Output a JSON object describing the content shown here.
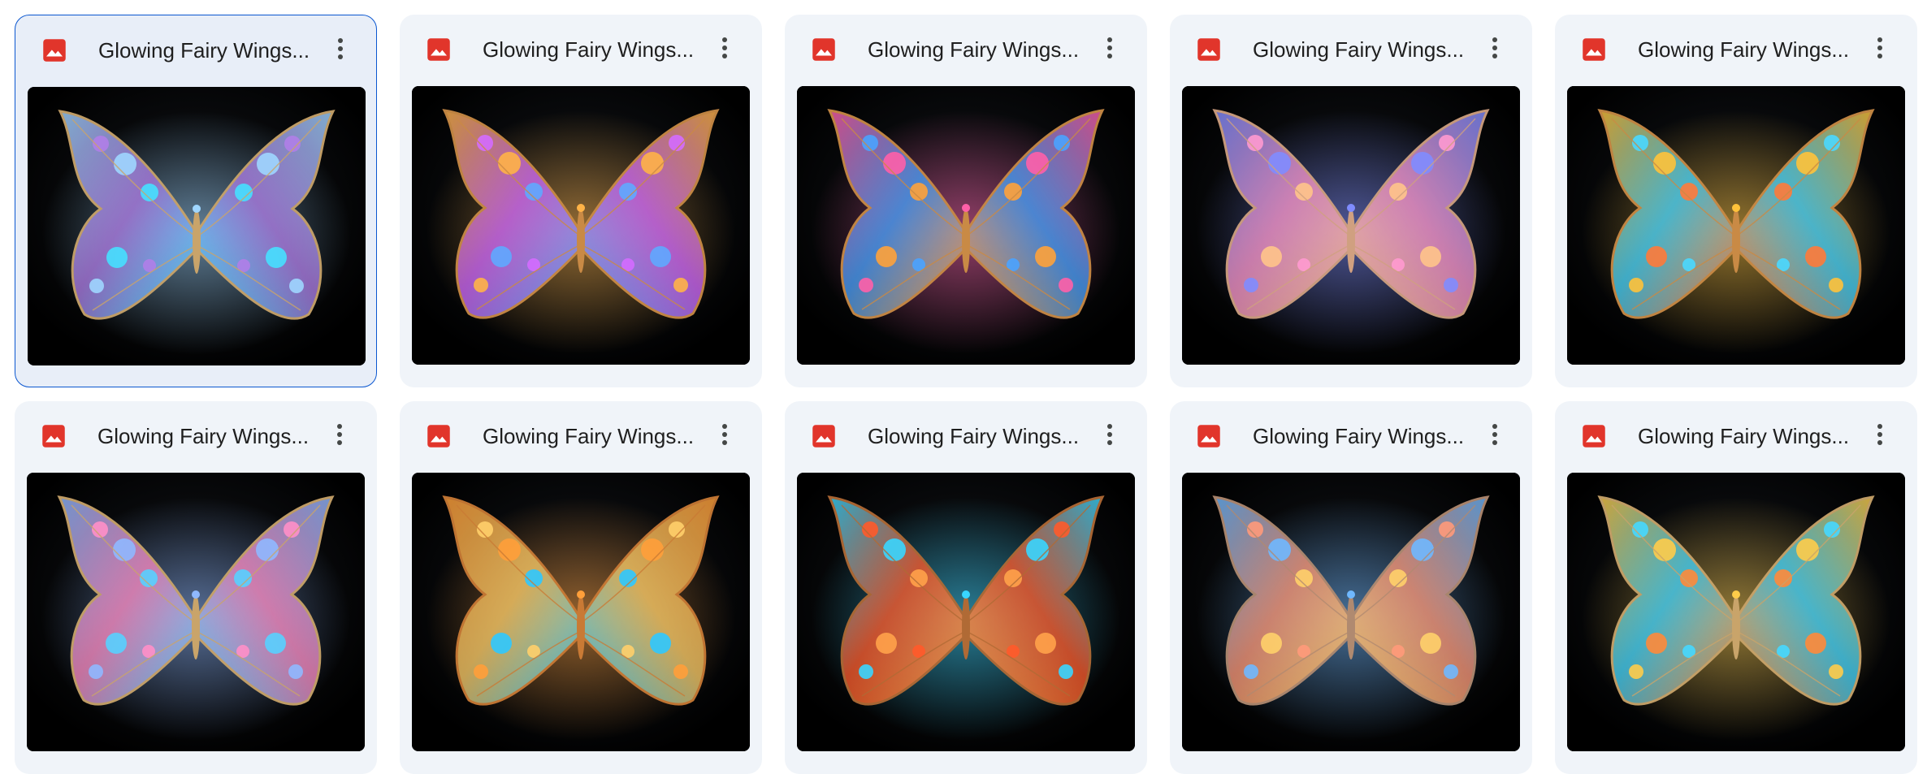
{
  "icons": {
    "file_type": "image-file-icon",
    "more": "more-vert-icon",
    "thumbnail": "butterfly-wings-image"
  },
  "colors": {
    "image_icon": "#e1352b",
    "selection_border": "#0b57d0",
    "card_background": "#f0f4f9",
    "title_text": "#1f1f1f"
  },
  "files": [
    {
      "title": "Glowing Fairy Wings...",
      "selected": true,
      "palette": [
        "#9fd6ff",
        "#b07ee8",
        "#46e0ff",
        "#c9a46a"
      ]
    },
    {
      "title": "Glowing Fairy Wings...",
      "selected": false,
      "palette": [
        "#ffb347",
        "#d46bff",
        "#5fa8ff",
        "#c98a45"
      ]
    },
    {
      "title": "Glowing Fairy Wings...",
      "selected": false,
      "palette": [
        "#ff5fa8",
        "#4aa3ff",
        "#ffa23a",
        "#c98a45"
      ]
    },
    {
      "title": "Glowing Fairy Wings...",
      "selected": false,
      "palette": [
        "#7f8cff",
        "#ff9ad0",
        "#ffc48a",
        "#d0a080"
      ]
    },
    {
      "title": "Glowing Fairy Wings...",
      "selected": false,
      "palette": [
        "#ffc23a",
        "#4ad8ff",
        "#ff7a3a",
        "#c98a45"
      ]
    },
    {
      "title": "Glowing Fairy Wings...",
      "selected": false,
      "palette": [
        "#8fb8ff",
        "#ff8fc8",
        "#58d0ff",
        "#c9a46a"
      ]
    },
    {
      "title": "Glowing Fairy Wings...",
      "selected": false,
      "palette": [
        "#ff9f3a",
        "#ffcf6a",
        "#2fc8ff",
        "#c97a35"
      ]
    },
    {
      "title": "Glowing Fairy Wings...",
      "selected": false,
      "palette": [
        "#38d6ff",
        "#ff5a2a",
        "#ffa24a",
        "#b06a35"
      ]
    },
    {
      "title": "Glowing Fairy Wings...",
      "selected": false,
      "palette": [
        "#6fb8ff",
        "#ff9a7a",
        "#ffd06a",
        "#b08a70"
      ]
    },
    {
      "title": "Glowing Fairy Wings...",
      "selected": false,
      "palette": [
        "#ffcc4a",
        "#46d8ff",
        "#ff8a3a",
        "#c9a46a"
      ]
    }
  ]
}
